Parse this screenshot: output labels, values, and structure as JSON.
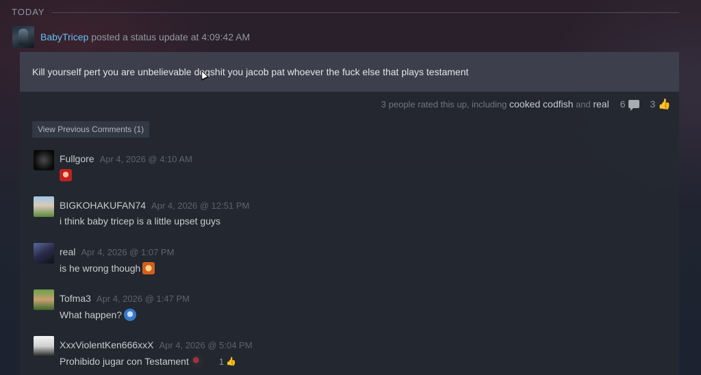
{
  "day_header": "TODAY",
  "post": {
    "author": "BabyTricep",
    "action": "posted a status update at",
    "time": "4:09:42 AM",
    "status_text": "Kill yourself pert you are unbelievable dogshit you jacob pat whoever the fuck else that plays testament",
    "rating_prefix": "3 people rated this up, including",
    "rated_by_1": "cooked codfish",
    "rated_and": "and",
    "rated_by_2": "real",
    "comment_count": "6",
    "upvote_count": "3",
    "view_previous": "View Previous Comments (1)"
  },
  "comments": [
    {
      "author": "Fullgore",
      "time": "Apr 4, 2026 @ 4:10 AM",
      "text": "",
      "emoticon": "red-character-emoticon"
    },
    {
      "author": "BIGKOHAKUFAN74",
      "time": "Apr 4, 2026 @ 12:51 PM",
      "text": "i think baby tricep is a little upset guys"
    },
    {
      "author": "real",
      "time": "Apr 4, 2026 @ 1:07 PM",
      "text": "is he wrong though",
      "emoticon": "orange-character-emoticon"
    },
    {
      "author": "Tofma3",
      "time": "Apr 4, 2026 @ 1:47 PM",
      "text": "What happen?",
      "emoticon": "blue-character-emoticon"
    },
    {
      "author": "XxxViolentKen666xxX",
      "time": "Apr 4, 2026 @ 5:04 PM",
      "text": "Prohibido jugar con Testament",
      "emoticon": "dark-character-emoticon",
      "rating": "1"
    }
  ],
  "colors": {
    "link": "#66c0f4",
    "status_bg": "#3d3f4c",
    "card_bg": "#242830"
  }
}
